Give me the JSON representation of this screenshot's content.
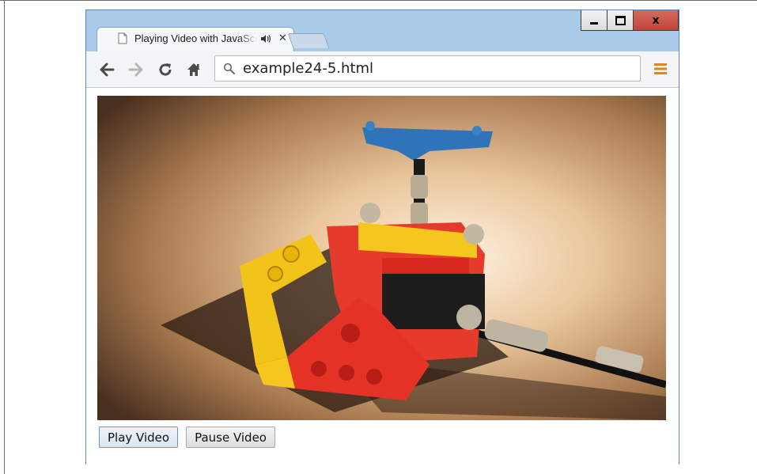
{
  "window": {
    "close_label": "x"
  },
  "tab": {
    "title": "Playing Video with JavaScript"
  },
  "toolbar": {
    "url": "example24-5.html"
  },
  "page": {
    "play_label": "Play Video",
    "pause_label": "Pause Video"
  },
  "icons": {
    "back": "back-arrow-icon",
    "forward": "forward-arrow-icon",
    "reload": "reload-icon",
    "home": "home-icon",
    "search": "search-icon",
    "menu": "hamburger-menu-icon",
    "page": "page-icon",
    "audio": "speaker-icon",
    "close": "close-icon"
  },
  "colors": {
    "title_bar": "#a9cae8",
    "close_button": "#c04638",
    "menu_accent": "#e8831a",
    "video_background": "#e7c49a"
  }
}
